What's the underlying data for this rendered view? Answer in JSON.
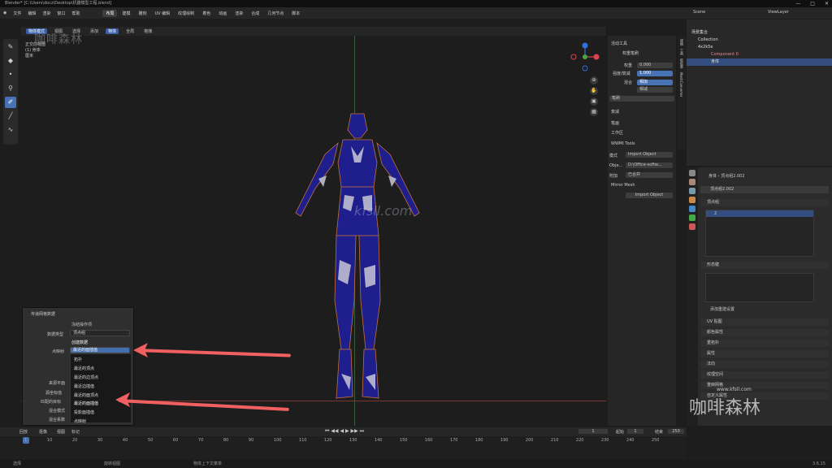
{
  "title_bar": {
    "text": "Blender* [C:\\Users\\docz\\Desktop\\机器模型工程.blend]",
    "controls": [
      "—",
      "□",
      "✕"
    ]
  },
  "menu": {
    "items": [
      "文件",
      "编辑",
      "渲染",
      "窗口",
      "帮助"
    ],
    "workspaces": [
      "布局",
      "建模",
      "雕刻",
      "UV 编辑",
      "纹理绘制",
      "着色",
      "动画",
      "渲染",
      "合成",
      "几何节点",
      "脚本"
    ],
    "active_workspace": "布局"
  },
  "scene_bar": {
    "scene": "Scene",
    "view_layer": "ViewLayer"
  },
  "viewport": {
    "header": {
      "mode": "物体模式",
      "view": "视图",
      "select": "选择",
      "add": "添加",
      "object": "物体",
      "orientation": "全局",
      "pivot": "拖拽"
    },
    "info": {
      "line1": "正交前视图",
      "line2": "(1) 身体",
      "line3": "厘米"
    },
    "watermark_1": "咖啡森林",
    "watermark_2": "kfsll.com",
    "watermark_3": "咖啡森林",
    "watermark_4": "www.kfsll.com"
  },
  "toolbar": {
    "icons": [
      "brush-icon",
      "drop-icon",
      "dot-icon",
      "eyedropper-icon",
      "active-tool-icon",
      "pen-icon",
      "curve-icon"
    ]
  },
  "npanel": {
    "active_tool_title": "活动工具",
    "weight_paint": "权重笔刷",
    "weight_label": "权重",
    "weight_value": "0.000",
    "radius_label": "强度/衰减",
    "radius_value": "1.000",
    "blend_label": "混合",
    "blend_value": "相加",
    "falloff_value": "相减",
    "brush_label": "笔刷",
    "sections": [
      "衰减",
      "笔画",
      "工作区"
    ],
    "wwmi_title": "WWMI Tools",
    "mode_label": "模式",
    "mode_value": "Import Object",
    "object_label": "Obje...",
    "object_value": "D:\\Office-softw...",
    "tex_label": "附加",
    "tex_value": "已合并",
    "mirror_mesh": "Mirror Mesh",
    "import_button": "Import Object"
  },
  "side_tabs": [
    "视图",
    "工具",
    "WWMI",
    "MeshConverter"
  ],
  "outliner": {
    "header": "场景集合",
    "rows": [
      {
        "label": "Collection",
        "indent": 0,
        "selected": false
      },
      {
        "label": "4x2k5e",
        "indent": 0,
        "selected": false
      },
      {
        "label": "Component 0",
        "indent": 1,
        "selected": false
      },
      {
        "label": "身体",
        "indent": 1,
        "selected": true
      }
    ]
  },
  "properties": {
    "breadcrumb_object": "身体",
    "breadcrumb_data": "顶点组2.002",
    "data_name": "顶点组2.002",
    "vertex_groups_title": "顶点组",
    "vertex_group_item": "2",
    "shape_keys_title": "形态键",
    "auto_smooth": "添加重建设置",
    "sections": [
      "UV 贴图",
      "颜色属性",
      "重拓扑",
      "属性",
      "法向",
      "纹理空间",
      "重映网格",
      "自定义属性"
    ]
  },
  "popup": {
    "title": "传递网格数据",
    "freeze": "冻结操作项",
    "data_type_label": "数据类型",
    "data_type_value": "顶点组",
    "create_data": "创建数据",
    "vertex_map_label": "点映射",
    "vertex_map_value": "最近的面插值",
    "mix_mode_label": "来源平面",
    "mix_source_label": "源坐标值",
    "mix_factor_label": "匹配的目标",
    "layer_mix_label": "混合模式",
    "mix_factor": "混合系数",
    "options": [
      "拓扑",
      "最近的顶点",
      "最近的边顶点",
      "最近边插值",
      "最近的面顶点",
      "最近的面插值",
      "投影面插值"
    ],
    "bottom_option": "点映射"
  },
  "timeline": {
    "header_items": [
      "回放",
      "抠像",
      "视图",
      "标记"
    ],
    "current_frame": "1",
    "start_label": "起始",
    "start": "1",
    "end_label": "结束",
    "end": "250",
    "ticks": [
      "1",
      "10",
      "20",
      "30",
      "40",
      "50",
      "60",
      "70",
      "80",
      "90",
      "100",
      "110",
      "120",
      "130",
      "140",
      "150",
      "160",
      "170",
      "180",
      "190",
      "200",
      "210",
      "220",
      "230",
      "240",
      "250"
    ]
  },
  "status_bar": {
    "left": "选择",
    "mid": "旋转视图",
    "right": "物体上下文菜单",
    "version": "3.6.15"
  },
  "colors": {
    "accent": "#4772b3",
    "arrow": "#f06060",
    "model_blue": "#1e1e8c"
  }
}
